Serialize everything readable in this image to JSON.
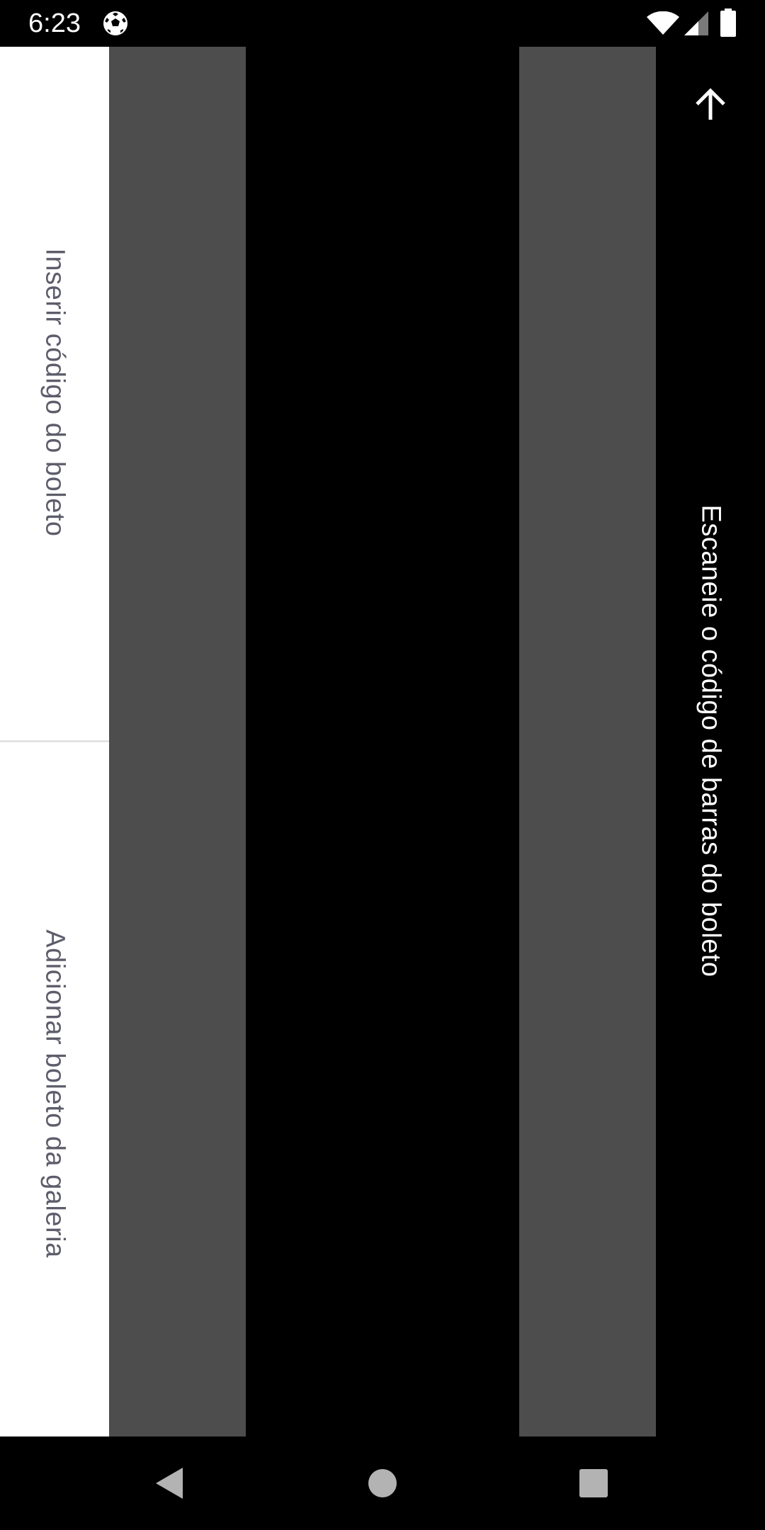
{
  "status_bar": {
    "time": "6:23",
    "icons": [
      "soccer-ball-icon",
      "wifi-icon",
      "cell-signal-icon",
      "battery-icon"
    ]
  },
  "options": {
    "insert_code_label": "Inserir código do boleto",
    "add_from_gallery_label": "Adicionar boleto da galeria"
  },
  "scanner": {
    "instruction": "Escaneie o código de barras do boleto",
    "back_icon": "arrow-up-icon"
  },
  "navigation_bar": {
    "icons": [
      "nav-back-icon",
      "nav-home-icon",
      "nav-recents-icon"
    ]
  },
  "colors": {
    "options_background": "#ffffff",
    "option_text": "#5d5d6b",
    "scan_overlay": "#4d4d4d",
    "background": "#000000",
    "instruction_text": "#ffffff"
  }
}
